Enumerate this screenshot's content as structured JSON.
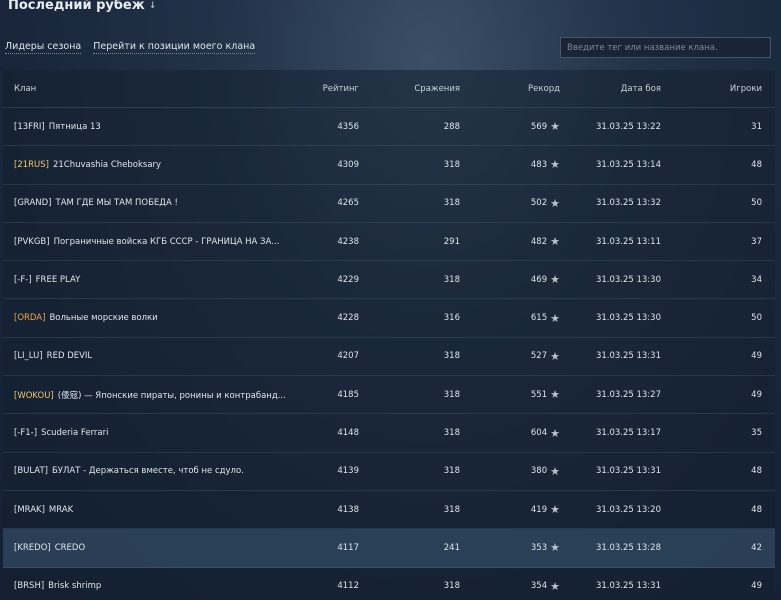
{
  "header": {
    "title": "Последний рубеж",
    "arrow": "↓"
  },
  "links": {
    "season_leaders": "Лидеры сезона",
    "goto_clan": "Перейти к позиции моего клана"
  },
  "search": {
    "placeholder": "Введите тег или название клана."
  },
  "columns": {
    "clan": "Клан",
    "rating": "Рейтинг",
    "battles": "Сражения",
    "record": "Рекорд",
    "date": "Дата боя",
    "players": "Игроки"
  },
  "colors": {
    "accent_gold": "#f1c76a",
    "accent_orange": "#f0a646",
    "tag_default": "#dfe5ea"
  },
  "rows": [
    {
      "tag": "[13FRI]",
      "tag_color": "#dfe5ea",
      "name": "Пятница 13",
      "rating": "4356",
      "battles": "288",
      "record": "569",
      "date": "31.03.25 13:22",
      "players": "31"
    },
    {
      "tag": "[21RUS]",
      "tag_color": "#f1c76a",
      "name": "21Chuvashia Cheboksary",
      "rating": "4309",
      "battles": "318",
      "record": "483",
      "date": "31.03.25 13:14",
      "players": "48"
    },
    {
      "tag": "[GRAND]",
      "tag_color": "#dfe5ea",
      "name": "ТАМ ГДЕ МЫ ТАМ ПОБЕДА !",
      "rating": "4265",
      "battles": "318",
      "record": "502",
      "date": "31.03.25 13:32",
      "players": "50"
    },
    {
      "tag": "[PVKGB]",
      "tag_color": "#dfe5ea",
      "name": "Пограничные войска КГБ СССР - ГРАНИЦА НА ЗА...",
      "rating": "4238",
      "battles": "291",
      "record": "482",
      "date": "31.03.25 13:11",
      "players": "37"
    },
    {
      "tag": "[-F-]",
      "tag_color": "#dfe5ea",
      "name": "FREE PLAY",
      "rating": "4229",
      "battles": "318",
      "record": "469",
      "date": "31.03.25 13:30",
      "players": "34"
    },
    {
      "tag": "[ORDA]",
      "tag_color": "#f0a646",
      "name": "Вольные морские волки",
      "rating": "4228",
      "battles": "316",
      "record": "615",
      "date": "31.03.25 13:30",
      "players": "50"
    },
    {
      "tag": "[LI_LU]",
      "tag_color": "#dfe5ea",
      "name": "RED DEVIL",
      "rating": "4207",
      "battles": "318",
      "record": "527",
      "date": "31.03.25 13:31",
      "players": "49"
    },
    {
      "tag": "[WOKOU]",
      "tag_color": "#f1c76a",
      "name": "(倭寇) — Японские пираты, ронины и контрабанд...",
      "rating": "4185",
      "battles": "318",
      "record": "551",
      "date": "31.03.25 13:27",
      "players": "49"
    },
    {
      "tag": "[-F1-]",
      "tag_color": "#dfe5ea",
      "name": "Scuderia Ferrari",
      "rating": "4148",
      "battles": "318",
      "record": "604",
      "date": "31.03.25 13:17",
      "players": "35"
    },
    {
      "tag": "[BULAT]",
      "tag_color": "#dfe5ea",
      "name": "БУЛАТ - Держаться вместе, чтоб не сдуло.",
      "rating": "4139",
      "battles": "318",
      "record": "380",
      "date": "31.03.25 13:31",
      "players": "48"
    },
    {
      "tag": "[MRAK]",
      "tag_color": "#dfe5ea",
      "name": "MRAK",
      "rating": "4138",
      "battles": "318",
      "record": "419",
      "date": "31.03.25 13:20",
      "players": "48"
    },
    {
      "tag": "[KREDO]",
      "tag_color": "#dfe5ea",
      "name": "CREDO",
      "rating": "4117",
      "battles": "241",
      "record": "353",
      "date": "31.03.25 13:28",
      "players": "42",
      "highlight": true
    },
    {
      "tag": "[BRSH]",
      "tag_color": "#dfe5ea",
      "name": "Brisk shrimp",
      "rating": "4112",
      "battles": "318",
      "record": "354",
      "date": "31.03.25 13:31",
      "players": "49"
    }
  ]
}
